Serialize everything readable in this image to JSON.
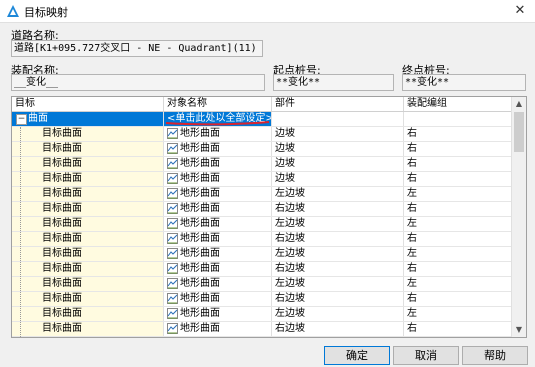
{
  "window": {
    "title": "目标映射"
  },
  "fields": {
    "road_label": "道路名称:",
    "road_value": "道路[K1+095.727交叉口 - NE - Quadrant](11)",
    "assembly_label": "装配名称:",
    "assembly_value": "__变化__",
    "start_label": "起点桩号:",
    "start_value": "**变化**",
    "end_label": "终点桩号:",
    "end_value": "**变化**"
  },
  "grid": {
    "columns": [
      "目标",
      "对象名称",
      "部件",
      "装配编组"
    ],
    "group": {
      "target": "曲面",
      "object": "<单击此处以全部设定>",
      "part": "",
      "assembly": ""
    },
    "rows": [
      {
        "target": "目标曲面",
        "object": "地形曲面",
        "part": "边坡",
        "assembly": "右"
      },
      {
        "target": "目标曲面",
        "object": "地形曲面",
        "part": "边坡",
        "assembly": "右"
      },
      {
        "target": "目标曲面",
        "object": "地形曲面",
        "part": "边坡",
        "assembly": "右"
      },
      {
        "target": "目标曲面",
        "object": "地形曲面",
        "part": "边坡",
        "assembly": "右"
      },
      {
        "target": "目标曲面",
        "object": "地形曲面",
        "part": "左边坡",
        "assembly": "左"
      },
      {
        "target": "目标曲面",
        "object": "地形曲面",
        "part": "右边坡",
        "assembly": "右"
      },
      {
        "target": "目标曲面",
        "object": "地形曲面",
        "part": "左边坡",
        "assembly": "左"
      },
      {
        "target": "目标曲面",
        "object": "地形曲面",
        "part": "右边坡",
        "assembly": "右"
      },
      {
        "target": "目标曲面",
        "object": "地形曲面",
        "part": "左边坡",
        "assembly": "左"
      },
      {
        "target": "目标曲面",
        "object": "地形曲面",
        "part": "右边坡",
        "assembly": "右"
      },
      {
        "target": "目标曲面",
        "object": "地形曲面",
        "part": "左边坡",
        "assembly": "左"
      },
      {
        "target": "目标曲面",
        "object": "地形曲面",
        "part": "右边坡",
        "assembly": "右"
      },
      {
        "target": "目标曲面",
        "object": "地形曲面",
        "part": "左边坡",
        "assembly": "左"
      },
      {
        "target": "目标曲面",
        "object": "地形曲面",
        "part": "右边坡",
        "assembly": "右"
      }
    ]
  },
  "buttons": {
    "ok": "确定",
    "cancel": "取消",
    "help": "帮助"
  },
  "colors": {
    "selection": "#0078d7",
    "target_col_bg": "#fffbe0",
    "annotation": "#d9232e"
  },
  "icons": {
    "app": "civil3d-icon",
    "close": "close-icon",
    "surface": "surface-icon"
  }
}
